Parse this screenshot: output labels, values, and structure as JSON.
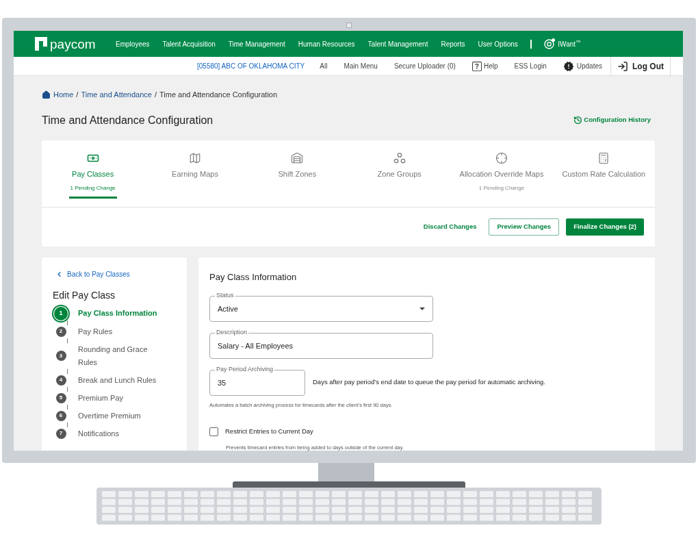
{
  "nav": {
    "logo": "paycom",
    "items": [
      "Employees",
      "Talent Acquisition",
      "Time Management",
      "Human Resources",
      "Talent Management",
      "Reports",
      "User Options"
    ],
    "iwant": "IWant$^{™}$"
  },
  "subnav": [
    {
      "label": "[05580] ABC OF OKLAHOMA CITY",
      "kind": "company"
    },
    {
      "label": "All",
      "kind": "link"
    },
    {
      "label": "Main Menu",
      "kind": "link"
    },
    {
      "label": "Secure Uploader (0)",
      "kind": "link"
    },
    {
      "label": "Help",
      "kind": "help"
    },
    {
      "label": "ESS Login",
      "kind": "link"
    },
    {
      "label": "Updates",
      "kind": "updates"
    },
    {
      "label": "Log Out",
      "kind": "logout"
    }
  ],
  "breadcrumb": [
    {
      "label": "Home",
      "kind": "home"
    },
    {
      "label": "Time and Attendance",
      "kind": "link",
      "separator": "/"
    },
    {
      "label": "Time and Attendance Configuration",
      "kind": "current",
      "separator": "/"
    }
  ],
  "title": "Time and Attendance Configuration",
  "history": "Configuration History",
  "tabs": [
    {
      "label": "Pay Classes",
      "kind": "money",
      "selected": true,
      "pending": "1 Pending Change"
    },
    {
      "label": "Earning Maps",
      "kind": "map",
      "selected": false
    },
    {
      "label": "Shift Zones",
      "kind": "building",
      "selected": false
    },
    {
      "label": "Zone Groups",
      "kind": "dots",
      "selected": false
    },
    {
      "label": "Allocation Override Maps",
      "kind": "target",
      "selected": false,
      "pending": "1 Pending Change"
    },
    {
      "label": "Custom Rate Calculation",
      "kind": "calculator",
      "selected": false
    }
  ],
  "actions": {
    "discard": "Discard Changes",
    "preview": "Preview Changes",
    "finalize": "Finalize Changes (2)"
  },
  "side": {
    "back": "Back to Pay Classes",
    "title": "Edit Pay Class",
    "steps": [
      {
        "number": "1",
        "label": "Pay Class Information",
        "selected": true
      },
      {
        "number": "2",
        "label": "Pay Rules",
        "selected": false
      },
      {
        "number": "3",
        "label": "Rounding and Grace Rules",
        "selected": false
      },
      {
        "number": "4",
        "label": "Break and Lunch Rules",
        "selected": false
      },
      {
        "number": "5",
        "label": "Premium Pay",
        "selected": false
      },
      {
        "number": "6",
        "label": "Overtime Premium",
        "selected": false
      },
      {
        "number": "7",
        "label": "Notifications",
        "selected": false
      }
    ]
  },
  "form": {
    "title": "Pay Class Information",
    "status": {
      "label": "Status",
      "value": "Active"
    },
    "description": {
      "label": "Description",
      "value": "Salary - All Employees"
    },
    "archiving": {
      "label": "Pay Period Archiving",
      "value": "35",
      "suffix": "Days after pay period’s end date to queue the pay period for automatic archiving.",
      "help": "Automates a batch archiving process for timecards after the client’s first 90 days."
    },
    "restrict": {
      "label": "Restrict Entries to Current Day",
      "checked": false,
      "help": "Prevents timecard entries from being added to days outside of the current day."
    }
  }
}
